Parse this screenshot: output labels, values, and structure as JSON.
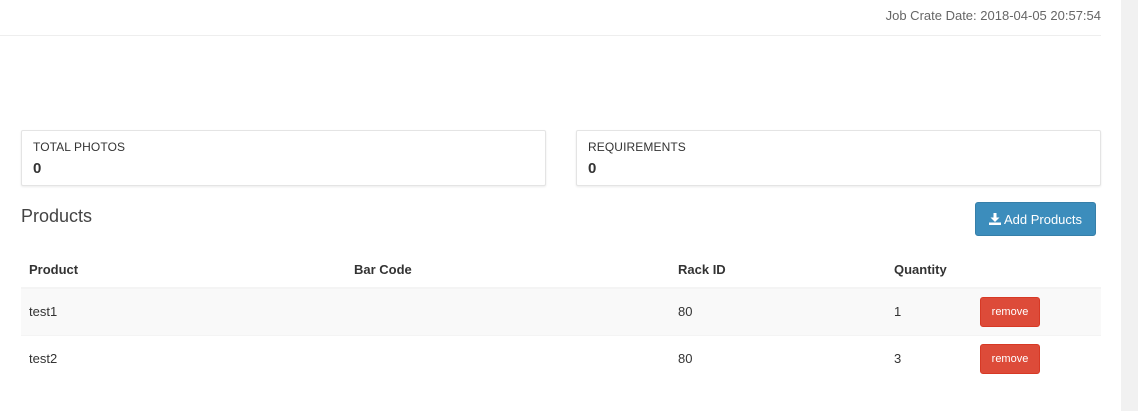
{
  "header": {
    "job_date_label": "Job Crate Date:",
    "job_date_value": "2018-04-05 20:57:54"
  },
  "stats": {
    "total_photos_label": "TOTAL PHOTOS",
    "total_photos_value": "0",
    "requirements_label": "REQUIREMENTS",
    "requirements_value": "0"
  },
  "products": {
    "title": "Products",
    "add_button_label": "Add Products",
    "columns": [
      "Product",
      "Bar Code",
      "Rack ID",
      "Quantity",
      ""
    ],
    "rows": [
      {
        "product": "test1",
        "bar_code": "",
        "rack_id": "80",
        "quantity": "1",
        "action": "remove"
      },
      {
        "product": "test2",
        "bar_code": "",
        "rack_id": "80",
        "quantity": "3",
        "action": "remove"
      }
    ]
  },
  "colors": {
    "primary": "#3c8dbc",
    "danger": "#dd4b39"
  },
  "icons": {
    "add_button_icon": "download-icon"
  }
}
